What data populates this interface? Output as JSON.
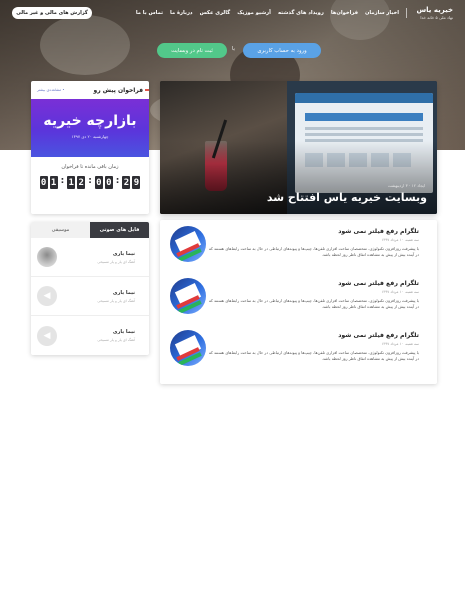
{
  "header": {
    "brand_title": "خیریه یاس",
    "brand_subtitle": "نهاد ملی ۵ خانه خدا",
    "nav": [
      "اخبار سازمان",
      "فراخوان‌ها",
      "رویداد های گذشته",
      "آرشیو موزیک",
      "گالری عکس",
      "دربارهٔ ما",
      "تماس با ما"
    ],
    "report_button": "گزارش های مالی و غیر مالی",
    "login_button": "ورود به حساب کاربری",
    "or_label": "یا",
    "register_button": "ثبت نام در وبسایت"
  },
  "featured": {
    "meta": "ایجاد ۱۲ · ۳ اردیبهشت",
    "headline": "وبسایت خیریه یاس افتتاح شد"
  },
  "call": {
    "title": "فراخوان پیش رو",
    "more": "• مشاهده‌ی بیشتر",
    "banner_title": "بازارچه خیریه",
    "banner_date": "چهارشنبه ۲۰ دی ۱۳۹۷",
    "remaining_label": "زمان باقی مانده تا فراخوان",
    "timer": [
      "0",
      "1",
      ":",
      "1",
      "2",
      ":",
      "0",
      "0",
      ":",
      "2",
      "9"
    ]
  },
  "audio": {
    "tabs": [
      "فایل های صوتی",
      "موسیقی"
    ],
    "items": [
      {
        "name": "نیما یاری",
        "sub": "آهنگ ای یار و یار مسیحی"
      },
      {
        "name": "نیما یاری",
        "sub": "آهنگ ای یار و یار مسیحی"
      },
      {
        "name": "نیما یاری",
        "sub": "آهنگ ای یار و یار مسیحی"
      }
    ]
  },
  "news": {
    "entries": [
      {
        "title": "تلگرام رفع فیلتر نمی شود",
        "date": "سه شنبه، ۱۰ مرداد ۱۳۹۷",
        "text": "با پیشرفت روز‌افزون تکنولوژی، متخصصان ساخت افزاری تلفن‌ها، چیپ‌ها و پیوندهای ارتباطی در حال به ساخت رابط‌های هستند که در آینده بیش از پیش به مشاهده اتفاق ناظر روز لحظه باشد."
      },
      {
        "title": "تلگرام رفع فیلتر نمی شود",
        "date": "سه شنبه، ۱۰ مرداد ۱۳۹۷",
        "text": "با پیشرفت روز‌افزون تکنولوژی، متخصصان ساخت افزاری تلفن‌ها، چیپ‌ها و پیوندهای ارتباطی در حال به ساخت رابط‌های هستند که در آینده بیش از پیش به مشاهده اتفاق ناظر روز لحظه باشد."
      },
      {
        "title": "تلگرام رفع فیلتر نمی شود",
        "date": "سه شنبه، ۱۰ مرداد ۱۳۹۷",
        "text": "با پیشرفت روز‌افزون تکنولوژی، متخصصان ساخت افزاری تلفن‌ها، چیپ‌ها و پیوندهای ارتباطی در حال به ساخت رابط‌های هستند که در آینده بیش از پیش به مشاهده اتفاق ناظر روز لحظه باشد."
      }
    ]
  },
  "colors": {
    "login": "#5aa2e6",
    "register": "#52c88a",
    "banner_top": "#7a2fd6",
    "banner_bottom": "#4a54e0",
    "accent_mark": "#e1574a",
    "active_tab": "#3a3b41"
  }
}
